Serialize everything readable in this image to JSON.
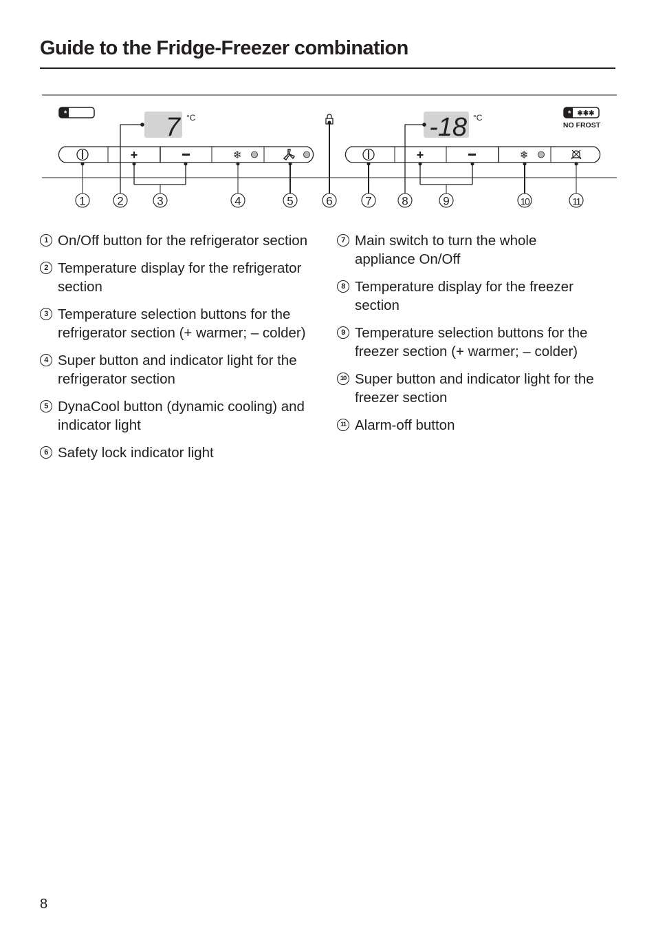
{
  "page": {
    "title": "Guide to the Fridge-Freezer combination",
    "page_number": "8"
  },
  "control_panel": {
    "fridge": {
      "temperature_display": "7",
      "unit": "°C",
      "buttons": [
        "on-off",
        "plus",
        "minus",
        "super-cool",
        "dynacool"
      ],
      "plus_label": "+",
      "minus_label": "−"
    },
    "freezer": {
      "temperature_display": "-18",
      "unit": "°C",
      "buttons": [
        "main-switch",
        "plus",
        "minus",
        "super-freeze",
        "alarm-off"
      ],
      "plus_label": "+",
      "minus_label": "−",
      "badge_stars": "✱✱✱",
      "badge_caption": "NO FROST"
    },
    "callout_numbers": [
      "1",
      "2",
      "3",
      "4",
      "5",
      "6",
      "7",
      "8",
      "9",
      "10",
      "11"
    ],
    "colors": {
      "display_bg": "#d3d3d3",
      "indicator_light": "#b8b8b8",
      "line": "#231f20"
    }
  },
  "legend": {
    "left": [
      {
        "num": "1",
        "text": "On/Off button for the refrigerator section"
      },
      {
        "num": "2",
        "text": "Temperature display for the refrigerator section"
      },
      {
        "num": "3",
        "text": "Temperature selection buttons for the refrigerator section (+ warmer; – colder)"
      },
      {
        "num": "4",
        "text": "Super button and indicator light for the refrigerator section"
      },
      {
        "num": "5",
        "text": "DynaCool button (dynamic cooling) and indicator light"
      },
      {
        "num": "6",
        "text": "Safety lock indicator light"
      }
    ],
    "right": [
      {
        "num": "7",
        "text": "Main switch to turn the whole appliance On/Off"
      },
      {
        "num": "8",
        "text": "Temperature display for the freezer section"
      },
      {
        "num": "9",
        "text": "Temperature selection buttons for the freezer section (+ warmer; – colder)"
      },
      {
        "num": "10",
        "text": "Super button and indicator light for the freezer section"
      },
      {
        "num": "11",
        "text": "Alarm-off button"
      }
    ]
  }
}
